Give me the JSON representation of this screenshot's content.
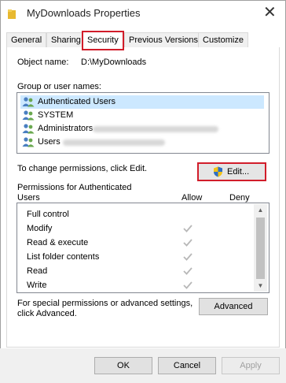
{
  "window": {
    "title": "MyDownloads Properties",
    "close_label": "✕",
    "folder_icon": "folder-icon"
  },
  "tabs": [
    {
      "label": "General"
    },
    {
      "label": "Sharing"
    },
    {
      "label": "Security",
      "active": true
    },
    {
      "label": "Previous Versions"
    },
    {
      "label": "Customize"
    }
  ],
  "security": {
    "object_name_label": "Object name:",
    "object_name_value": "D:\\MyDownloads",
    "group_label": "Group or user names:",
    "users": [
      {
        "name": "Authenticated Users",
        "selected": true
      },
      {
        "name": "SYSTEM"
      },
      {
        "name": "Administrators"
      },
      {
        "name": "Users"
      }
    ],
    "change_text": "To change permissions, click Edit.",
    "edit_button": "Edit...",
    "permissions_label_line1": "Permissions for Authenticated",
    "permissions_label_line2": "Users",
    "allow_header": "Allow",
    "deny_header": "Deny",
    "permissions": [
      {
        "name": "Full control",
        "allow": false
      },
      {
        "name": "Modify",
        "allow": true
      },
      {
        "name": "Read & execute",
        "allow": true
      },
      {
        "name": "List folder contents",
        "allow": true
      },
      {
        "name": "Read",
        "allow": true
      },
      {
        "name": "Write",
        "allow": true
      }
    ],
    "special_text_line1": "For special permissions or advanced settings,",
    "special_text_line2": "click Advanced.",
    "advanced_button": "Advanced"
  },
  "footer": {
    "ok": "OK",
    "cancel": "Cancel",
    "apply": "Apply"
  },
  "colors": {
    "highlight_border": "#d11d2a",
    "selected_row": "#cce8ff",
    "check_color": "#b8b8b8"
  }
}
